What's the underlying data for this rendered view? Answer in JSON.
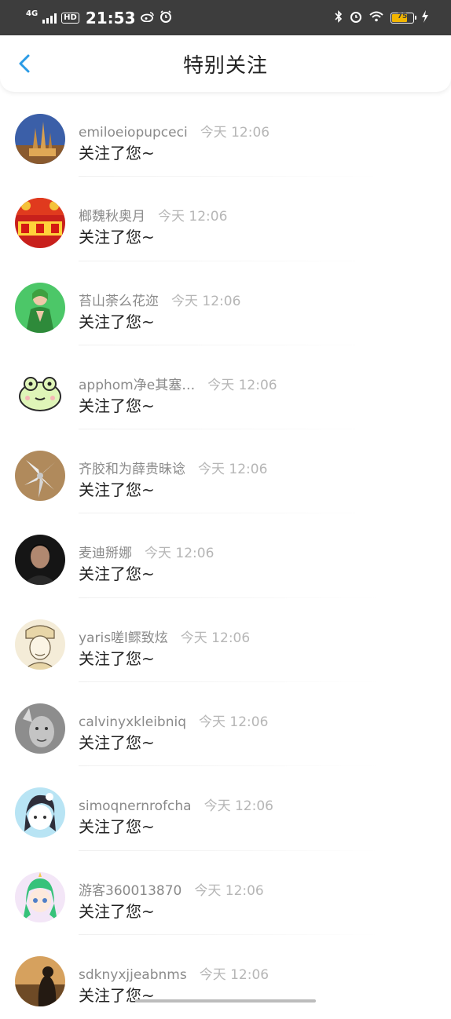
{
  "status_bar": {
    "network": "4G",
    "hd": "HD",
    "time": "21:53",
    "battery": "75",
    "battery_level": 0.75,
    "icons": [
      "signal-icon",
      "weibo-icon",
      "alarm-icon",
      "bluetooth-icon",
      "wifi-icon",
      "charging-icon"
    ]
  },
  "header": {
    "title": "特别关注",
    "back_icon": "chevron-left-icon",
    "accent": "#2a9be6"
  },
  "notifications": [
    {
      "name": "emiloeiopupceci",
      "time": "今天 12:06",
      "message": "关注了您~",
      "avatar_icon": "castle-avatar"
    },
    {
      "name": "榔魏秋奥月",
      "time": "今天 12:06",
      "message": "关注了您~",
      "avatar_icon": "jianjunjie-avatar"
    },
    {
      "name": "苔山荼么花迩",
      "time": "今天 12:06",
      "message": "关注了您~",
      "avatar_icon": "green-girl-avatar"
    },
    {
      "name": "apphom净e其塞…",
      "time": "今天 12:06",
      "message": "关注了您~",
      "avatar_icon": "frog-avatar"
    },
    {
      "name": "齐胶和为薛贵昧谂",
      "time": "今天 12:06",
      "message": "关注了您~",
      "avatar_icon": "flower-avatar"
    },
    {
      "name": "麦迪掰娜",
      "time": "今天 12:06",
      "message": "关注了您~",
      "avatar_icon": "man-portrait-avatar"
    },
    {
      "name": "yaris嗟l鳏致炫",
      "time": "今天 12:06",
      "message": "关注了您~",
      "avatar_icon": "sketch-avatar"
    },
    {
      "name": "calvinyxkleibniq",
      "time": "今天 12:06",
      "message": "关注了您~",
      "avatar_icon": "bw-man-avatar"
    },
    {
      "name": "simoqnernrofcha",
      "time": "今天 12:06",
      "message": "关注了您~",
      "avatar_icon": "anime-girl-avatar"
    },
    {
      "name": "游客360013870",
      "time": "今天 12:06",
      "message": "关注了您~",
      "avatar_icon": "green-hair-anime-avatar"
    },
    {
      "name": "sdknyxjjeabnms",
      "time": "今天 12:06",
      "message": "关注了您~",
      "avatar_icon": "dark-sunset-avatar"
    }
  ]
}
